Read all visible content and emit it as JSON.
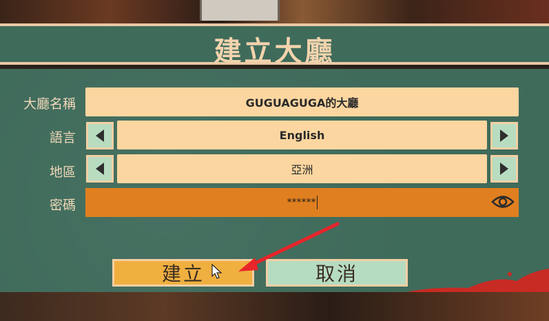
{
  "title": "建立大廳",
  "form": {
    "lobby_name": {
      "label": "大廳名稱",
      "value": "GUGUAGUGA的大廳"
    },
    "language": {
      "label": "語言",
      "value": "English"
    },
    "region": {
      "label": "地區",
      "value": "亞洲"
    },
    "password": {
      "label": "密碼",
      "value": "******"
    }
  },
  "buttons": {
    "create": "建立",
    "cancel": "取消"
  },
  "colors": {
    "panel": "#3f6b5b",
    "field": "#fcd6a0",
    "password_field": "#e07f20",
    "create_button": "#f0b040",
    "cancel_button": "#b6dcc0",
    "annotation_arrow": "#e8252a"
  },
  "icons": {
    "prev": "triangle-left-icon",
    "next": "triangle-right-icon",
    "show_password": "eye-icon",
    "pointer": "mouse-cursor-icon"
  }
}
